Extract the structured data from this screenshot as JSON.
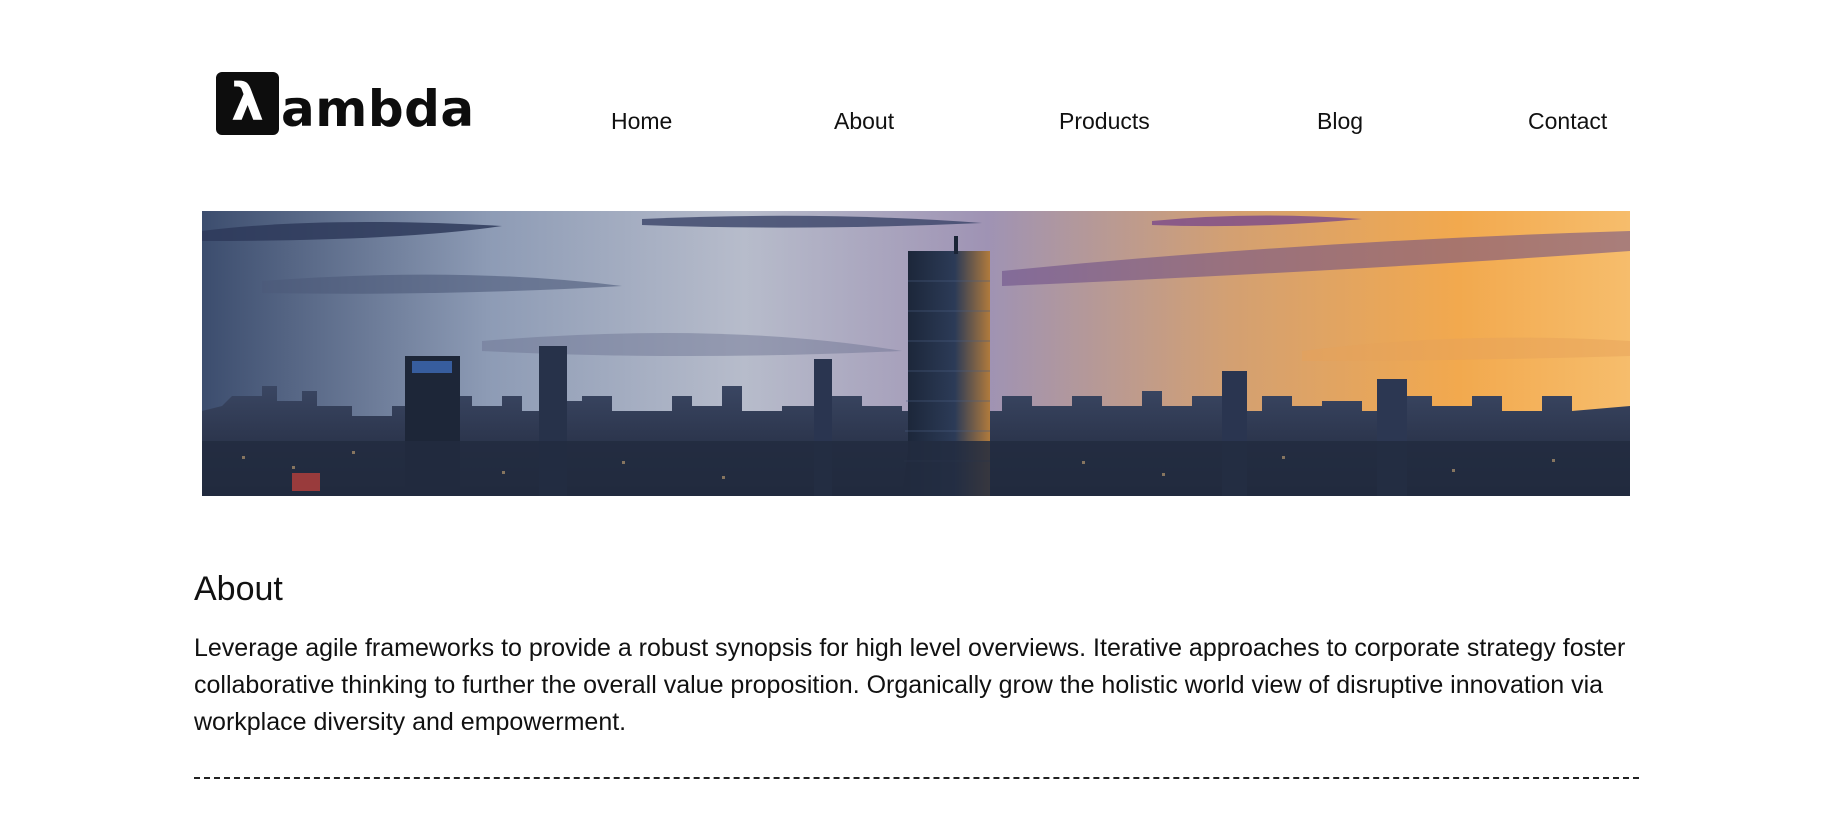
{
  "logo": {
    "mark": "λ",
    "text": "ambda"
  },
  "nav": {
    "items": [
      {
        "label": "Home"
      },
      {
        "label": "About"
      },
      {
        "label": "Products"
      },
      {
        "label": "Blog"
      },
      {
        "label": "Contact"
      }
    ]
  },
  "banner": {
    "image": "city-skyline-sunset"
  },
  "about": {
    "title": "About",
    "body": "Leverage agile frameworks to provide a robust synopsis for high level overviews. Iterative approaches to corporate strategy foster collaborative thinking to further the overall value proposition. Organically grow the holistic world view of disruptive innovation via workplace diversity and empowerment."
  },
  "colors": {
    "text": "#111111",
    "logo": "#0d0d0d",
    "background": "#ffffff"
  }
}
